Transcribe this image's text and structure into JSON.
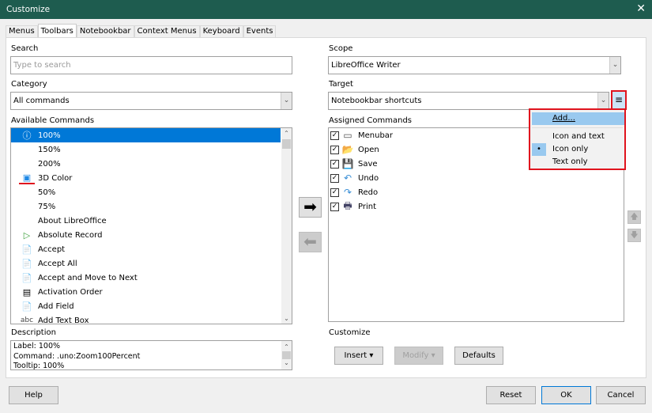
{
  "window": {
    "title": "Customize",
    "close_icon": "✕"
  },
  "tabs": [
    "Menus",
    "Toolbars",
    "Notebookbar",
    "Context Menus",
    "Keyboard",
    "Events"
  ],
  "left": {
    "search_label": "Search",
    "search_placeholder": "Type to search",
    "category_label": "Category",
    "category_value": "All commands",
    "available_label": "Available Commands",
    "commands": [
      {
        "label": "100%",
        "icon": "zoom-100-icon"
      },
      {
        "label": "150%",
        "icon": ""
      },
      {
        "label": "200%",
        "icon": ""
      },
      {
        "label": "3D Color",
        "icon": "3d-color-icon"
      },
      {
        "label": "50%",
        "icon": ""
      },
      {
        "label": "75%",
        "icon": ""
      },
      {
        "label": "About LibreOffice",
        "icon": ""
      },
      {
        "label": "Absolute Record",
        "icon": "absolute-record-icon"
      },
      {
        "label": "Accept",
        "icon": "accept-icon"
      },
      {
        "label": "Accept All",
        "icon": "accept-all-icon"
      },
      {
        "label": "Accept and Move to Next",
        "icon": "accept-next-icon"
      },
      {
        "label": "Activation Order",
        "icon": "activation-order-icon"
      },
      {
        "label": "Add Field",
        "icon": "add-field-icon"
      },
      {
        "label": "Add Text Box",
        "icon": "abc"
      }
    ],
    "description_label": "Description",
    "description": [
      "Label: 100%",
      "Command: .uno:Zoom100Percent",
      "Tooltip: 100%"
    ]
  },
  "right": {
    "scope_label": "Scope",
    "scope_value": "LibreOffice Writer",
    "target_label": "Target",
    "target_value": "Notebookbar shortcuts",
    "assigned_label": "Assigned Commands",
    "assigned": [
      {
        "label": "Menubar",
        "checked": true
      },
      {
        "label": "Open",
        "checked": true
      },
      {
        "label": "Save",
        "checked": true
      },
      {
        "label": "Undo",
        "checked": true
      },
      {
        "label": "Redo",
        "checked": true
      },
      {
        "label": "Print",
        "checked": true
      }
    ],
    "customize_label": "Customize",
    "insert": "Insert",
    "modify": "Modify",
    "defaults": "Defaults"
  },
  "menu": {
    "add": "Add...",
    "icon_and_text": "Icon and text",
    "icon_only": "Icon only",
    "text_only": "Text only",
    "selected": "Icon only"
  },
  "footer": {
    "help": "Help",
    "reset": "Reset",
    "ok": "OK",
    "cancel": "Cancel"
  },
  "colors": {
    "titlebar": "#1e5c4f",
    "selection": "#0078d7",
    "highlight": "#e0141e"
  }
}
